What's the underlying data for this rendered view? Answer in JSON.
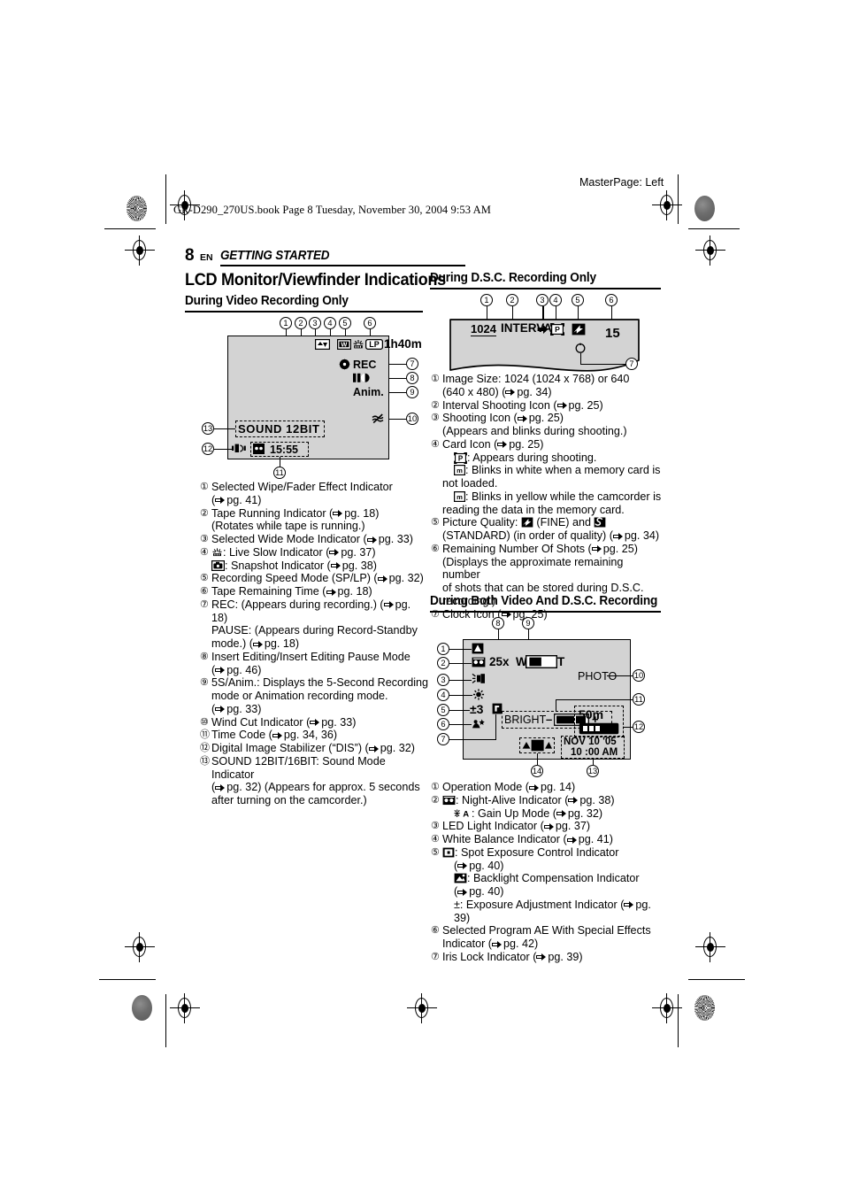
{
  "print_marks": {
    "book_line": "GR-D290_270US.book  Page 8  Tuesday, November 30, 2004  9:53 AM",
    "master_page": "MasterPage: Left"
  },
  "page_header": {
    "page_number": "8",
    "language_code": "EN",
    "chapter": "GETTING STARTED"
  },
  "main_title": "LCD Monitor/Viewfinder Indications",
  "sections": {
    "video_only": {
      "title": "During Video Recording Only",
      "diagram": {
        "callouts": [
          "1",
          "2",
          "3",
          "4",
          "5",
          "6",
          "7",
          "8",
          "9",
          "10",
          "11",
          "12",
          "13"
        ],
        "screen_text": {
          "tape_remaining": "1h40m",
          "speed_mode": "LP",
          "wide_mode": "W",
          "rec": "REC",
          "anim": "Anim.",
          "sound_mode": "SOUND  12BIT",
          "time_code": "15:55"
        }
      },
      "items": [
        {
          "num": "1",
          "lines": [
            "Selected Wipe/Fader Effect Indicator",
            "(—pg. 41)"
          ]
        },
        {
          "num": "2",
          "lines": [
            "Tape Running Indicator (—pg. 18)",
            "(Rotates while tape is running.)"
          ]
        },
        {
          "num": "3",
          "lines": [
            "Selected Wide Mode Indicator (—pg. 33)"
          ]
        },
        {
          "num": "4",
          "lines": [
            ": Live Slow Indicator (—pg. 37)",
            ": Snapshot Indicator (—pg. 38)"
          ]
        },
        {
          "num": "5",
          "lines": [
            "Recording Speed Mode (SP/LP) (—pg. 32)"
          ]
        },
        {
          "num": "6",
          "lines": [
            "Tape Remaining Time (—pg. 18)"
          ]
        },
        {
          "num": "7",
          "lines": [
            "REC: (Appears during recording.) (—pg. 18)",
            "PAUSE: (Appears during Record-Standby",
            "mode.) (—pg. 18)"
          ]
        },
        {
          "num": "8",
          "lines": [
            "Insert Editing/Insert Editing Pause Mode",
            "(—pg. 46)"
          ]
        },
        {
          "num": "9",
          "lines": [
            "5S/Anim.: Displays the 5-Second Recording",
            "mode or Animation recording mode.",
            "(—pg. 33)"
          ]
        },
        {
          "num": "10",
          "lines": [
            "Wind Cut Indicator (—pg. 33)"
          ]
        },
        {
          "num": "11",
          "lines": [
            "Time Code (—pg. 34, 36)"
          ]
        },
        {
          "num": "12",
          "lines": [
            "Digital Image Stabilizer (“DIS”) (—pg. 32)"
          ]
        },
        {
          "num": "13",
          "lines": [
            "SOUND 12BIT/16BIT: Sound Mode Indicator",
            "(—pg. 32) (Appears for approx. 5 seconds",
            "after turning on the camcorder.)"
          ]
        }
      ]
    },
    "dsc_only": {
      "title": "During D.S.C. Recording Only",
      "diagram": {
        "callouts": [
          "1",
          "2",
          "3",
          "4",
          "5",
          "6",
          "7"
        ],
        "screen_text": {
          "image_size": "1024",
          "interval": "INTERVAL",
          "remaining_shots": "15"
        }
      },
      "items": [
        {
          "num": "1",
          "lines": [
            "Image Size: 1024 (1024 x 768) or 640",
            "(640 x 480) (—pg. 34)"
          ]
        },
        {
          "num": "2",
          "lines": [
            "Interval Shooting Icon (—pg. 25)"
          ]
        },
        {
          "num": "3",
          "lines": [
            "Shooting Icon (—pg. 25)",
            "(Appears and blinks during shooting.)"
          ]
        },
        {
          "num": "4",
          "lines": [
            "Card Icon (—pg. 25)",
            ": Appears during shooting.",
            ": Blinks in white when a memory card is",
            "not loaded.",
            ": Blinks in yellow while the camcorder is",
            "reading the data in the memory card."
          ]
        },
        {
          "num": "5",
          "lines": [
            "Picture Quality:  (FINE) and",
            "(STANDARD) (in order of quality) (—pg. 34)"
          ]
        },
        {
          "num": "6",
          "lines": [
            "Remaining Number Of Shots (—pg. 25)",
            "(Displays the approximate remaining number",
            "of shots that can be stored during D.S.C.",
            "recording.)"
          ]
        },
        {
          "num": "7",
          "lines": [
            "Clock Icon (—pg. 25)"
          ]
        }
      ]
    },
    "both": {
      "title": "During Both Video And D.S.C. Recording",
      "diagram": {
        "callouts": [
          "1",
          "2",
          "3",
          "4",
          "5",
          "6",
          "7",
          "8",
          "9",
          "10",
          "11",
          "12",
          "13",
          "14"
        ],
        "screen_text": {
          "zoom": "25x",
          "zoom_wide": "W",
          "zoom_tele": "T",
          "photo": "PHOTO",
          "exposure_value": "±3",
          "bright": "BRIGHT",
          "bright_minus": "–",
          "bright_plus": "+",
          "tape_remaining": "50m",
          "date": "NOV 10 '05",
          "time": "10 :00  AM"
        }
      },
      "items": [
        {
          "num": "1",
          "lines": [
            "Operation Mode (—pg. 14)"
          ]
        },
        {
          "num": "2",
          "lines": [
            ": Night-Alive Indicator (—pg. 38)",
            ": Gain Up Mode (—pg. 32)"
          ]
        },
        {
          "num": "3",
          "lines": [
            "LED Light Indicator (—pg. 37)"
          ]
        },
        {
          "num": "4",
          "lines": [
            "White Balance Indicator (—pg. 41)"
          ]
        },
        {
          "num": "5",
          "lines": [
            ": Spot Exposure Control Indicator",
            "(—pg. 40)",
            ": Backlight Compensation Indicator",
            "(—pg. 40)",
            "±: Exposure Adjustment Indicator (—pg. 39)"
          ]
        },
        {
          "num": "6",
          "lines": [
            "Selected Program AE With Special Effects",
            "Indicator (—pg. 42)"
          ]
        },
        {
          "num": "7",
          "lines": [
            "Iris Lock Indicator (—pg. 39)"
          ]
        }
      ]
    }
  }
}
